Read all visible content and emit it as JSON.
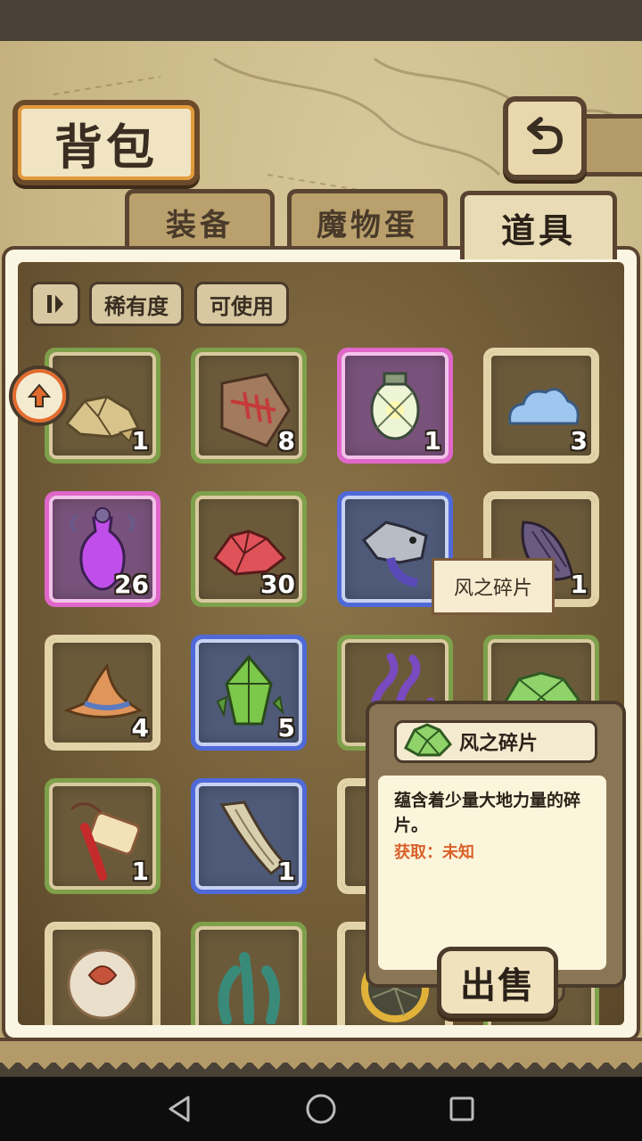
{
  "header": {
    "title": "背包"
  },
  "tabs": [
    {
      "label": "装备",
      "active": false
    },
    {
      "label": "魔物蛋",
      "active": false
    },
    {
      "label": "道具",
      "active": true
    }
  ],
  "filters": {
    "rarity": "稀有度",
    "usable": "可使用"
  },
  "grid": {
    "rows": [
      [
        {
          "icon": "gold-ore-icon",
          "rarity": "green",
          "count": "1"
        },
        {
          "icon": "fish-bone-tablet-icon",
          "rarity": "green",
          "count": "8"
        },
        {
          "icon": "lantern-icon",
          "rarity": "pink",
          "count": "1"
        },
        {
          "icon": "blue-cloud-icon",
          "rarity": "tan",
          "count": "3"
        }
      ],
      [
        {
          "icon": "purple-potion-icon",
          "rarity": "pink",
          "count": "26"
        },
        {
          "icon": "red-crystal-icon",
          "rarity": "green",
          "count": "30"
        },
        {
          "icon": "gray-beast-icon",
          "rarity": "blue",
          "count": ""
        },
        {
          "icon": "purple-shell-icon",
          "rarity": "tan",
          "count": "1"
        }
      ],
      [
        {
          "icon": "witch-hat-icon",
          "rarity": "tan",
          "count": "4"
        },
        {
          "icon": "green-crystal-icon",
          "rarity": "blue",
          "count": "5"
        },
        {
          "icon": "purple-tentacle-icon",
          "rarity": "green",
          "count": ""
        },
        {
          "icon": "green-shard-icon",
          "rarity": "green",
          "count": ""
        }
      ],
      [
        {
          "icon": "red-tassel-charm-icon",
          "rarity": "green",
          "count": "1"
        },
        {
          "icon": "wooden-plank-icon",
          "rarity": "blue",
          "count": "1"
        },
        {
          "icon": "unknown-item-icon",
          "rarity": "tan",
          "count": ""
        },
        {
          "icon": "unknown-item-icon",
          "rarity": "tan",
          "count": ""
        }
      ],
      [
        {
          "icon": "leaf-orb-icon",
          "rarity": "tan",
          "count": ""
        },
        {
          "icon": "seaweed-icon",
          "rarity": "green",
          "count": ""
        },
        {
          "icon": "net-ring-icon",
          "rarity": "tan",
          "count": ""
        },
        {
          "icon": "unknown-item-icon",
          "rarity": "green",
          "count": ""
        }
      ]
    ]
  },
  "hover_label": "风之碎片",
  "detail": {
    "name": "风之碎片",
    "description": "蕴含着少量大地力量的碎片。",
    "obtain": "获取：未知",
    "sell_label": "出售"
  },
  "colors": {
    "accent": "#d8622a",
    "frame": "#5a4330"
  }
}
